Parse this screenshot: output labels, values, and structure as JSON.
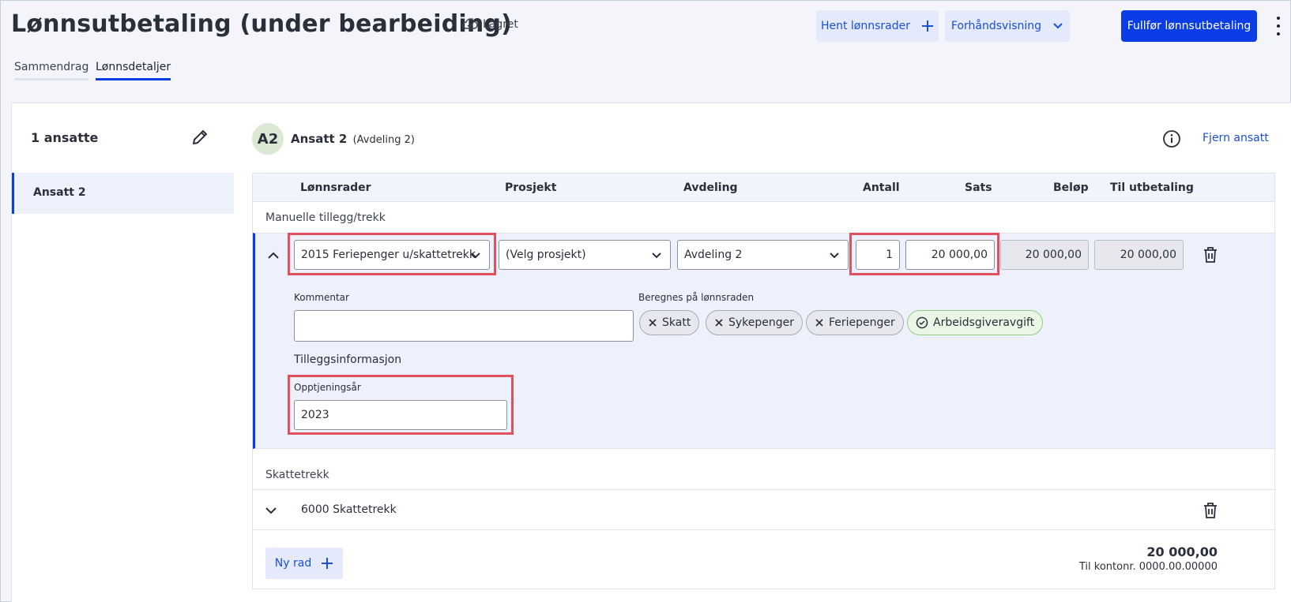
{
  "header": {
    "title": "Lønnsutbetaling (under bearbeiding)",
    "save_status": "Lagret",
    "fetch_rows_label": "Hent lønnsrader",
    "preview_label": "Forhåndsvisning",
    "complete_label": "Fullfør lønnsutbetaling"
  },
  "tabs": [
    "Sammendrag",
    "Lønnsdetaljer"
  ],
  "sidebar": {
    "count_label": "1 ansatte",
    "employees": [
      "Ansatt 2"
    ]
  },
  "employee": {
    "initials": "A2",
    "name": "Ansatt 2",
    "department": "(Avdeling 2)",
    "remove_label": "Fjern ansatt"
  },
  "table": {
    "columns": [
      "Lønnsrader",
      "Prosjekt",
      "Avdeling",
      "Antall",
      "Sats",
      "Beløp",
      "Til utbetaling"
    ],
    "section_manual": "Manuelle tillegg/trekk",
    "section_tax": "Skattetrekk",
    "manual_row": {
      "wage_type": "2015 Feriepenger u/skattetrekk",
      "project": "(Velg prosjekt)",
      "department": "Avdeling 2",
      "quantity": "1",
      "rate": "20 000,00",
      "amount": "20 000,00",
      "payout": "20 000,00"
    },
    "details": {
      "comment_label": "Kommentar",
      "comment_value": "",
      "calc_label": "Beregnes på lønnsraden",
      "chips": [
        {
          "label": "Skatt",
          "state": "off"
        },
        {
          "label": "Sykepenger",
          "state": "off"
        },
        {
          "label": "Feriepenger",
          "state": "off"
        },
        {
          "label": "Arbeidsgiveravgift",
          "state": "on"
        }
      ],
      "extra_info_label": "Tilleggsinformasjon",
      "earning_year_label": "Opptjeningsår",
      "earning_year_value": "2023"
    },
    "tax_row": {
      "name": "6000 Skattetrekk"
    },
    "new_row_label": "Ny rad",
    "total": "20 000,00",
    "account": "Til kontonr. 0000.00.00000"
  },
  "colors": {
    "primary": "#0b3de6",
    "highlight": "#e0505e",
    "light_button": "#e4eafb"
  }
}
